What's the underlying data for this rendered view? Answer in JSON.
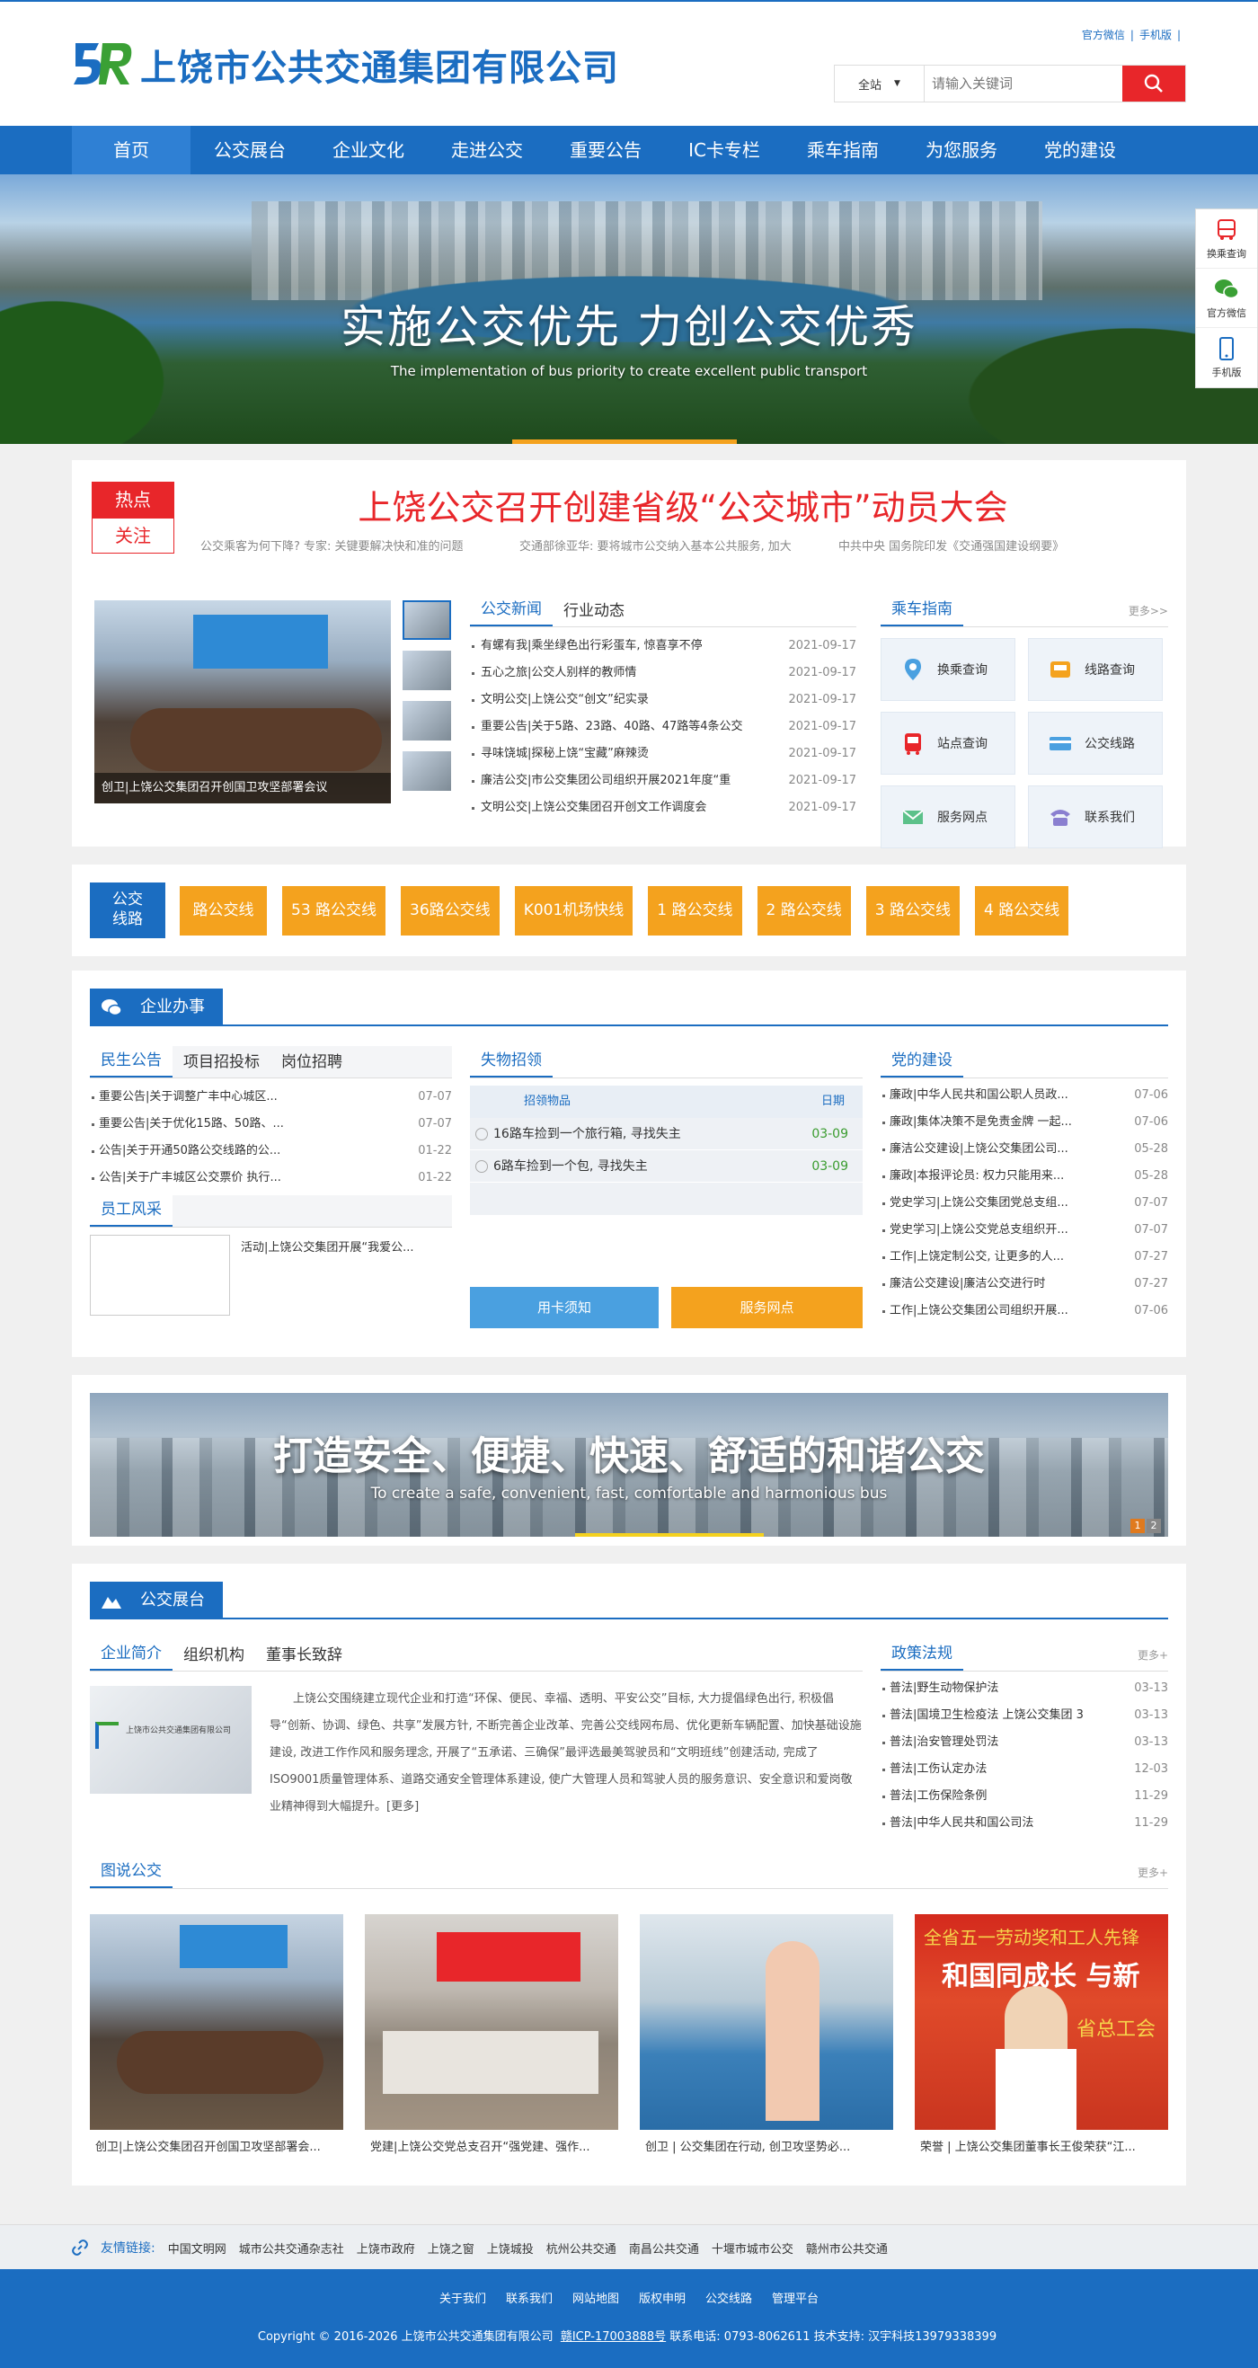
{
  "header": {
    "logo_text": "上饶市公共交通集团有限公司",
    "top_links": [
      "官方微信",
      "手机版"
    ],
    "search": {
      "scope": "全站",
      "placeholder": "请输入关键词"
    }
  },
  "nav": [
    "首页",
    "公交展台",
    "企业文化",
    "走进公交",
    "重要公告",
    "IC卡专栏",
    "乘车指南",
    "为您服务",
    "党的建设"
  ],
  "banner": {
    "title": "实施公交优先  力创公交优秀",
    "subtitle": "The implementation of bus priority to create excellent public transport"
  },
  "float_bar": [
    "换乘查询",
    "官方微信",
    "手机版"
  ],
  "hot": {
    "tag1": "热点",
    "tag2": "关注",
    "headline": "上饶公交召开创建省级“公交城市”动员大会",
    "subs": [
      "公交乘客为何下降? 专家: 关键要解决快和准的问题",
      "交通部徐亚华: 要将城市公交纳入基本公共服务, 加大",
      "中共中央 国务院印发《交通强国建设纲要》"
    ]
  },
  "news_image_caption": "创卫|上饶公交集团召开创国卫攻坚部署会议",
  "news": {
    "tabs": [
      "公交新闻",
      "行业动态"
    ],
    "items": [
      {
        "title": "有螺有我|乘坐绿色出行彩蛋车, 惊喜享不停",
        "date": "2021-09-17"
      },
      {
        "title": "五心之旅|公交人别样的教师情",
        "date": "2021-09-17"
      },
      {
        "title": "文明公交|上饶公交“创文”纪实录",
        "date": "2021-09-17"
      },
      {
        "title": "重要公告|关于5路、23路、40路、47路等4条公交",
        "date": "2021-09-17"
      },
      {
        "title": "寻味饶城|探秘上饶“宝藏”麻辣烫",
        "date": "2021-09-17"
      },
      {
        "title": "廉洁公交|市公交集团公司组织开展2021年度“重",
        "date": "2021-09-17"
      },
      {
        "title": "文明公交|上饶公交集团召开创文工作调度会",
        "date": "2021-09-17"
      }
    ]
  },
  "guide": {
    "title": "乘车指南",
    "more": "更多>>",
    "items": [
      "换乘查询",
      "线路查询",
      "站点查询",
      "公交线路",
      "服务网点",
      "联系我们"
    ]
  },
  "routes": {
    "label_line1": "公交",
    "label_line2": "线路",
    "items": [
      "路公交线",
      "53 路公交线",
      "36路公交线",
      "K001机场快线",
      "1 路公交线",
      "2 路公交线",
      "3 路公交线",
      "4 路公交线"
    ]
  },
  "business": {
    "title": "企业办事",
    "tabs": [
      "民生公告",
      "项目招投标",
      "岗位招聘"
    ],
    "notices": [
      {
        "title": "重要公告|关于调整广丰中心城区...",
        "date": "07-07"
      },
      {
        "title": "重要公告|关于优化15路、50路、...",
        "date": "07-07"
      },
      {
        "title": "公告|关于开通50路公交线路的公...",
        "date": "01-22"
      },
      {
        "title": "公告|关于广丰城区公交票价 执行...",
        "date": "01-22"
      }
    ],
    "staff_title": "员工风采",
    "staff_item": "活动|上饶公交集团开展“我爱公...",
    "lost": {
      "title": "失物招领",
      "col1": "招领物品",
      "col2": "日期",
      "items": [
        {
          "title": "16路车捡到一个旅行箱, 寻找失主",
          "date": "03-09"
        },
        {
          "title": "6路车捡到一个包, 寻找失主",
          "date": "03-09"
        }
      ],
      "btn1": "用卡须知",
      "btn2": "服务网点"
    },
    "party": {
      "title": "党的建设",
      "items": [
        {
          "title": "廉政|中华人民共和国公职人员政...",
          "date": "07-06"
        },
        {
          "title": "廉政|集体决策不是免责金牌 一起...",
          "date": "07-06"
        },
        {
          "title": "廉洁公交建设|上饶公交集团公司...",
          "date": "05-28"
        },
        {
          "title": "廉政|本报评论员: 权力只能用来...",
          "date": "05-28"
        },
        {
          "title": "党史学习|上饶公交集团党总支组...",
          "date": "07-07"
        },
        {
          "title": "党史学习|上饶公交党总支组织开...",
          "date": "07-07"
        },
        {
          "title": "工作|上饶定制公交, 让更多的人...",
          "date": "07-27"
        },
        {
          "title": "廉洁公交建设|廉洁公交进行时",
          "date": "07-27"
        },
        {
          "title": "工作|上饶公交集团公司组织开展...",
          "date": "07-06"
        }
      ]
    }
  },
  "slogan": {
    "title": "打造安全、便捷、快速、舒适的和谐公交",
    "subtitle": "To create a safe, convenient, fast, comfortable and harmonious bus",
    "pages": [
      "1",
      "2"
    ]
  },
  "showcase": {
    "title": "公交展台",
    "tabs": [
      "企业简介",
      "组织机构",
      "董事长致辞"
    ],
    "intro_img_text": "上饶市公共交通集团有限公司",
    "intro": "上饶公交围绕建立现代企业和打造“环保、便民、幸福、透明、平安公交”目标, 大力提倡绿色出行, 积极倡导“创新、协调、绿色、共享”发展方针, 不断完善企业改革、完善公交线网布局、优化更新车辆配置、加快基础设施建设, 改进工作作风和服务理念, 开展了“五承诺、三确保”最评选最美驾驶员和“文明班线”创建活动, 完成了ISO9001质量管理体系、道路交通安全管理体系建设, 使广大管理人员和驾驶人员的服务意识、安全意识和爱岗敬业精神得到大幅提升。[更多]",
    "policy": {
      "title": "政策法规",
      "more": "更多+",
      "items": [
        {
          "title": "普法|野生动物保护法",
          "date": "03-13"
        },
        {
          "title": "普法|国境卫生检疫法 上饶公交集团 3",
          "date": "03-13"
        },
        {
          "title": "普法|治安管理处罚法",
          "date": "03-13"
        },
        {
          "title": "普法|工伤认定办法",
          "date": "12-03"
        },
        {
          "title": "普法|工伤保险条例",
          "date": "11-29"
        },
        {
          "title": "普法|中华人民共和国公司法",
          "date": "11-29"
        }
      ]
    },
    "gallery_title": "图说公交",
    "gallery_more": "更多+",
    "gallery": [
      "创卫|上饶公交集团召开创国卫攻坚部署会...",
      "党建|上饶公交党总支召开“强党建、强作...",
      "创卫 | 公交集团在行动, 创卫攻坚势必...",
      "荣誉 | 上饶公交集团董事长王俊荣获“江..."
    ],
    "banner4_line1": "全省五一劳动奖和工人先锋",
    "banner4_line2": "和国同成长 与新",
    "banner4_line3": "省总工会"
  },
  "links": {
    "label": "友情链接:",
    "items": [
      "中国文明网",
      "城市公共交通杂志社",
      "上饶市政府",
      "上饶之窗",
      "上饶城投",
      "杭州公共交通",
      "南昌公共交通",
      "十堰市城市公交",
      "赣州市公共交通"
    ]
  },
  "footer": {
    "links": [
      "关于我们",
      "联系我们",
      "网站地图",
      "版权申明",
      "公交线路",
      "管理平台"
    ],
    "copyright": "Copyright © 2016-2026 上饶市公共交通集团有限公司",
    "icp": "赣ICP-17003888号",
    "contact": "联系电话: 0793-8062611 技术支持: 汉宇科技13979338399"
  },
  "colors": {
    "primary": "#1b6dc1",
    "accent_red": "#e8262a",
    "orange": "#f4a21e"
  }
}
